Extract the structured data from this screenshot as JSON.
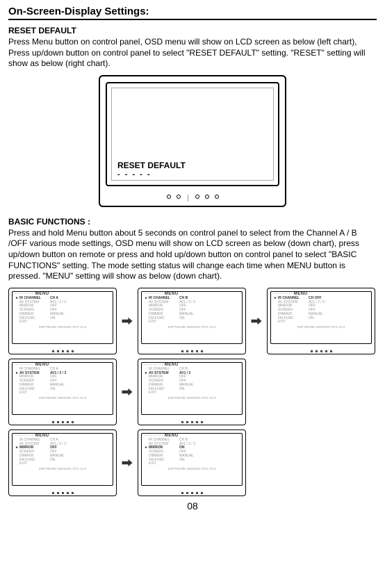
{
  "title": "On-Screen-Display Settings:",
  "reset": {
    "heading": "RESET DEFAULT",
    "para": "Press Menu button on control panel, OSD menu will show on LCD screen as below (left chart), Press up/down button on control panel to select \"RESET DEFAULT\" setting. \"RESET\" setting will show as below (right chart).",
    "label": "RESET DEFAULT",
    "dashes": "- - - - -"
  },
  "basic": {
    "heading": "BASIC FUNCTIONS :",
    "para": "Press and hold Menu button about 5 seconds on control panel to select from the Channel A / B /OFF various mode settings, OSD menu will show on LCD screen as below (down chart), press up/down button on remote or press and hold up/down button on control panel to select \"BASIC FUNCTIONS\" setting. The mode setting status will change each time when MENU button is pressed. \"MENU\" setting will show as below (down chart)."
  },
  "menu_label": "MENU",
  "dashes_line": "- - - - - - - - -",
  "sv": "SOFTWARE VERSION 7071 V1.0",
  "screens": [
    {
      "selected": 0,
      "rows": [
        [
          "IR CHANNEL",
          "CH   A"
        ],
        [
          "AV SYSTEM",
          "AV1 / 2 / 3"
        ],
        [
          "MIRROR",
          "OFF"
        ],
        [
          "SCREEN",
          "OFF"
        ],
        [
          "DIMMER",
          "MANUAL"
        ],
        [
          "FM-FUNC",
          "ON"
        ],
        [
          "EXIT",
          ""
        ]
      ]
    },
    {
      "selected": 0,
      "rows": [
        [
          "IR CHANNEL",
          "CH   B"
        ],
        [
          "AV SYSTEM",
          "AV1 / 2 / 3"
        ],
        [
          "MIRROR",
          "OFF"
        ],
        [
          "SCREEN",
          "OFF"
        ],
        [
          "DIMMER",
          "MANUAL"
        ],
        [
          "FM-FUNC",
          "ON"
        ],
        [
          "EXIT",
          ""
        ]
      ]
    },
    {
      "selected": 0,
      "rows": [
        [
          "IR CHANNEL",
          "CH   OFF"
        ],
        [
          "AV SYSTEM",
          "AV1 / 2 / 3"
        ],
        [
          "MIRROR",
          "OFF"
        ],
        [
          "SCREEN",
          "OFF"
        ],
        [
          "DIMMER",
          "MANUAL"
        ],
        [
          "FM-FUNC",
          "ON"
        ],
        [
          "EXIT",
          ""
        ]
      ]
    },
    {
      "selected": 1,
      "rows": [
        [
          "IR CHANNEL",
          "CH   A"
        ],
        [
          "AV SYSTEM",
          "AV1 / 2 / 3"
        ],
        [
          "MIRROR",
          "OFF"
        ],
        [
          "SCREEN",
          "OFF"
        ],
        [
          "DIMMER",
          "MANUAL"
        ],
        [
          "FM-FUNC",
          "ON"
        ],
        [
          "EXIT",
          ""
        ]
      ]
    },
    {
      "selected": 1,
      "rows": [
        [
          "IR CHANNEL",
          "CH   B"
        ],
        [
          "AV SYSTEM",
          "AV1 / 2"
        ],
        [
          "MIRROR",
          "OFF"
        ],
        [
          "SCREEN",
          "OFF"
        ],
        [
          "DIMMER",
          "MANUAL"
        ],
        [
          "FM-FUNC",
          "ON"
        ],
        [
          "EXIT",
          ""
        ]
      ]
    },
    {
      "selected": 2,
      "rows": [
        [
          "IR CHANNEL",
          "CH   A"
        ],
        [
          "AV SYSTEM",
          "AV1 / 2 / 3"
        ],
        [
          "MIRROR",
          "OFF"
        ],
        [
          "SCREEN",
          "OFF"
        ],
        [
          "DIMMER",
          "MANUAL"
        ],
        [
          "FM-FUNC",
          "ON"
        ],
        [
          "EXIT",
          ""
        ]
      ]
    },
    {
      "selected": 2,
      "rows": [
        [
          "IR CHANNEL",
          "CH   B"
        ],
        [
          "AV SYSTEM",
          "AV1 / 2 / 3"
        ],
        [
          "MIRROR",
          "ON"
        ],
        [
          "SCREEN",
          "OFF"
        ],
        [
          "DIMMER",
          "MANUAL"
        ],
        [
          "FM-FUNC",
          "ON"
        ],
        [
          "EXIT",
          ""
        ]
      ]
    }
  ],
  "pagenum": "08"
}
